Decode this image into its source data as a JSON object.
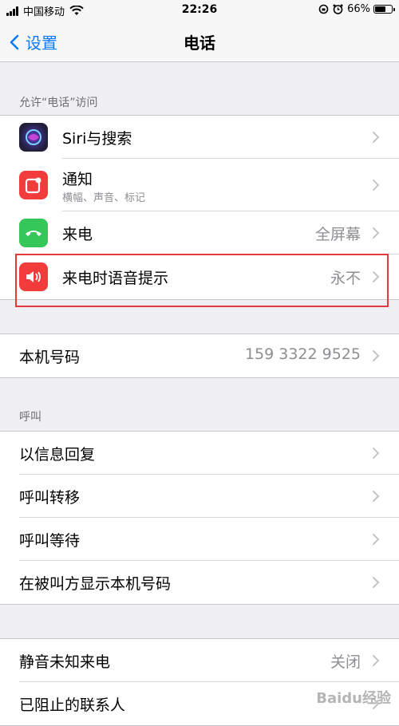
{
  "status_bar": {
    "carrier": "中国移动",
    "time": "22:26",
    "battery_percent": "66%",
    "battery_level": 0.66
  },
  "nav": {
    "back_label": "设置",
    "title": "电话"
  },
  "section_access": {
    "header": "允许“电话”访问",
    "items": [
      {
        "label": "Siri与搜索",
        "icon": "siri-icon",
        "color": "#1c1c3a"
      },
      {
        "label": "通知",
        "sublabel": "横幅、声音、标记",
        "icon": "notifications-icon",
        "color": "#f23b3b"
      },
      {
        "label": "来电",
        "value": "全屏幕",
        "icon": "phone-icon",
        "color": "#35c759"
      },
      {
        "label": "来电时语音提示",
        "value": "永不",
        "icon": "speaker-icon",
        "color": "#f23b3b"
      }
    ]
  },
  "my_number": {
    "label": "本机号码",
    "value": "159 3322 9525"
  },
  "section_calls": {
    "header": "呼叫",
    "items": [
      {
        "label": "以信息回复"
      },
      {
        "label": "呼叫转移"
      },
      {
        "label": "呼叫等待"
      },
      {
        "label": "在被叫方显示本机号码"
      }
    ]
  },
  "section_misc": {
    "items": [
      {
        "label": "静音未知来电",
        "value": "关闭"
      },
      {
        "label": "已阻止的联系人"
      }
    ]
  },
  "watermark": "Baidu经验",
  "colors": {
    "accent": "#0a7aff",
    "highlight": "#e23b3b"
  }
}
